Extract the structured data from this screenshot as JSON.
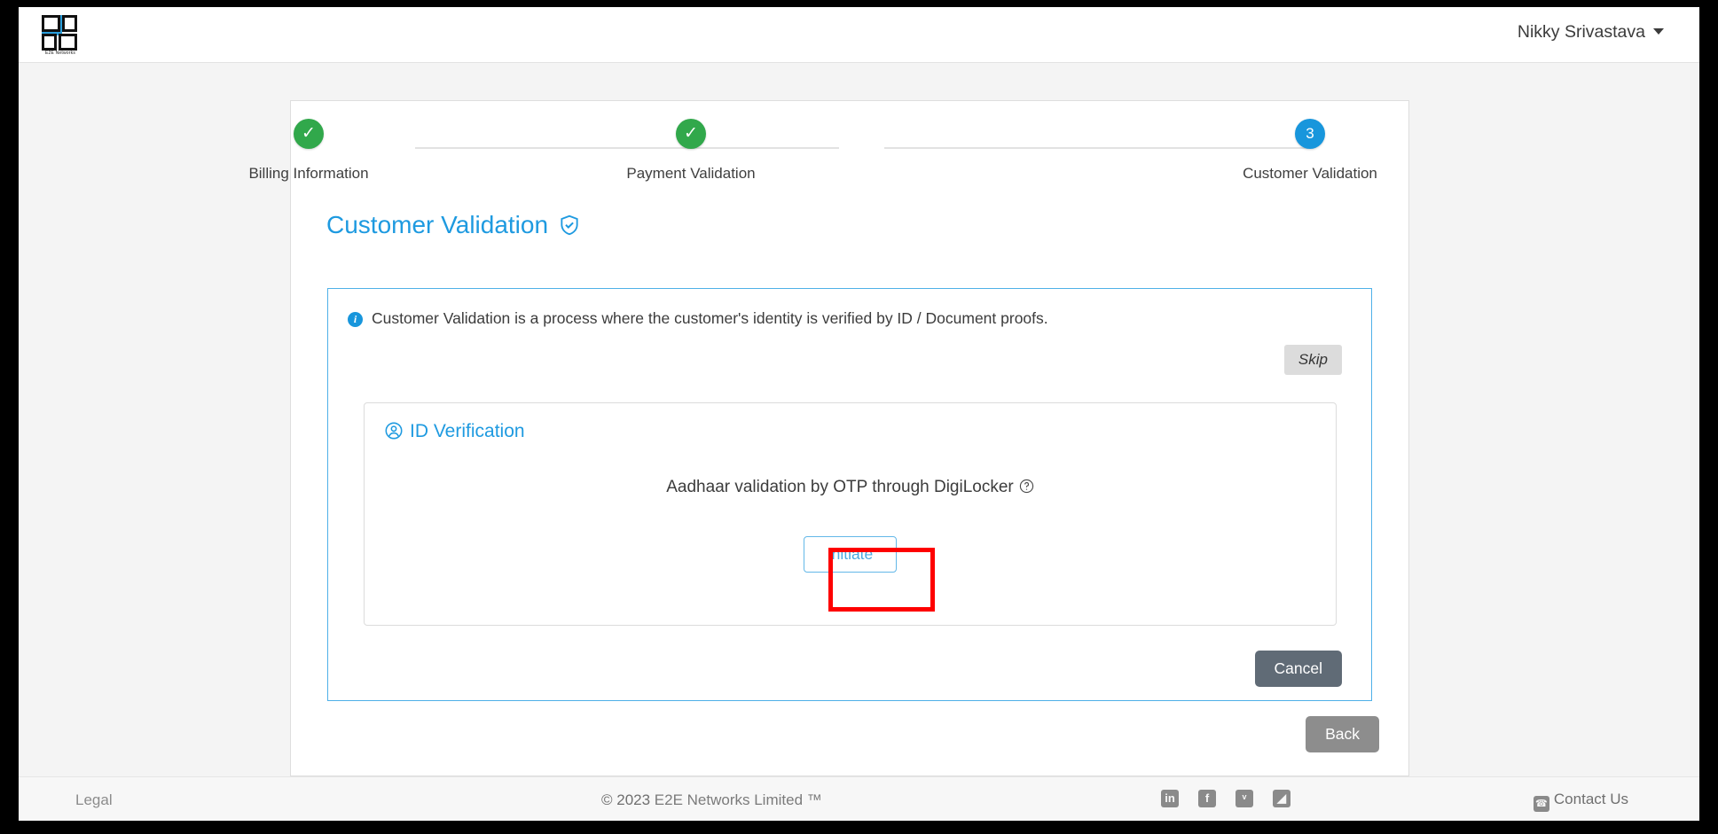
{
  "header": {
    "logo_name": "e2e-networks-logo",
    "logo_wordmark": "E2E Networks",
    "user_name": "Nikky Srivastava"
  },
  "stepper": {
    "steps": [
      {
        "label": "Billing Information",
        "state": "done",
        "marker": "✓"
      },
      {
        "label": "Payment Validation",
        "state": "done",
        "marker": "✓"
      },
      {
        "label": "Customer Validation",
        "state": "active",
        "marker": "3"
      }
    ]
  },
  "main": {
    "title": "Customer Validation",
    "info_text": "Customer Validation is a process where the customer's identity is verified by ID / Document proofs.",
    "info_badge": "i",
    "skip_label": "Skip",
    "verification": {
      "title": "ID Verification",
      "description": "Aadhaar validation by OTP through DigiLocker",
      "help_glyph": "?",
      "initiate_label": "Initiate"
    },
    "cancel_label": "Cancel",
    "back_label": "Back"
  },
  "footer": {
    "legal": "Legal",
    "copyright": "© 2023 ",
    "company": "E2E Networks Limited ™",
    "social": [
      {
        "name": "linkedin-icon",
        "glyph": "in"
      },
      {
        "name": "facebook-icon",
        "glyph": "f"
      },
      {
        "name": "twitter-icon",
        "glyph": "ᵛ"
      },
      {
        "name": "rss-icon",
        "glyph": "◢"
      }
    ],
    "contact_label": "Contact Us",
    "phone_glyph": "☎"
  },
  "colors": {
    "accent_blue": "#1e9ae0",
    "success_green": "#31a84b",
    "highlight_red": "#fe0000",
    "cancel_gray": "#606b76",
    "back_gray": "#8d8d8d"
  }
}
